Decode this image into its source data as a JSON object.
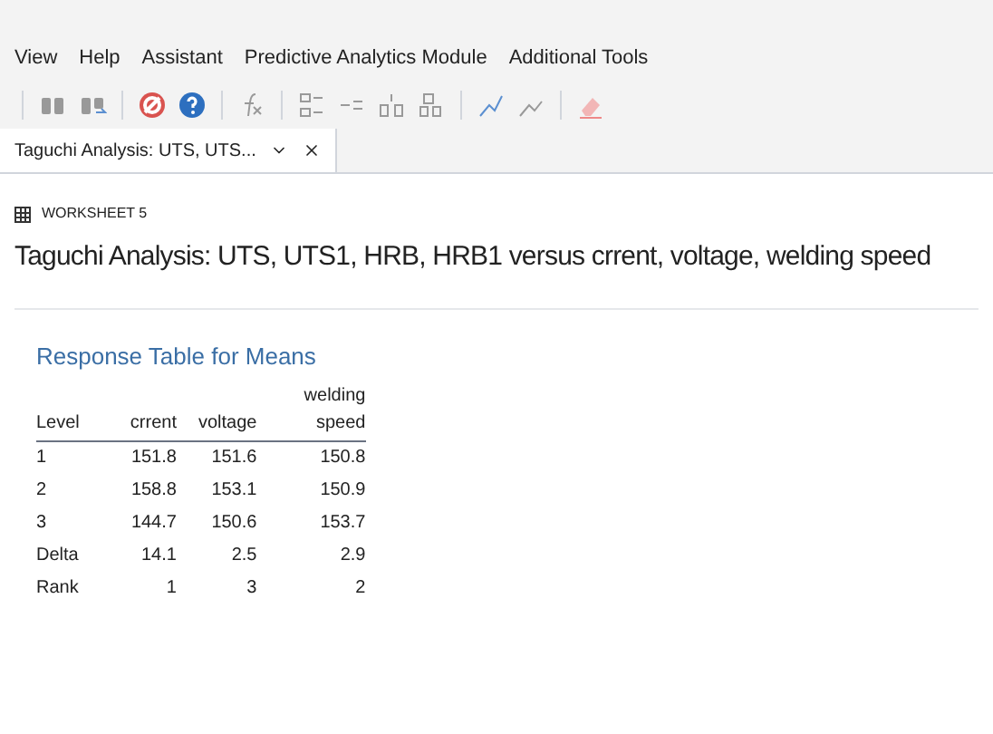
{
  "menu": [
    "View",
    "Help",
    "Assistant",
    "Predictive Analytics Module",
    "Additional Tools"
  ],
  "tab": {
    "label": "Taguchi Analysis: UTS, UTS...",
    "selected": true
  },
  "worksheet": "WORKSHEET 5",
  "title": "Taguchi Analysis: UTS, UTS1, HRB, HRB1 versus crrent, voltage, welding speed",
  "table": {
    "title": "Response Table for Means",
    "columns": [
      "Level",
      "crrent",
      "voltage",
      "welding speed"
    ],
    "rows": [
      [
        "1",
        "151.8",
        "151.6",
        "150.8"
      ],
      [
        "2",
        "158.8",
        "153.1",
        "150.9"
      ],
      [
        "3",
        "144.7",
        "150.6",
        "153.7"
      ],
      [
        "Delta",
        "14.1",
        "2.5",
        "2.9"
      ],
      [
        "Rank",
        "1",
        "3",
        "2"
      ]
    ]
  }
}
